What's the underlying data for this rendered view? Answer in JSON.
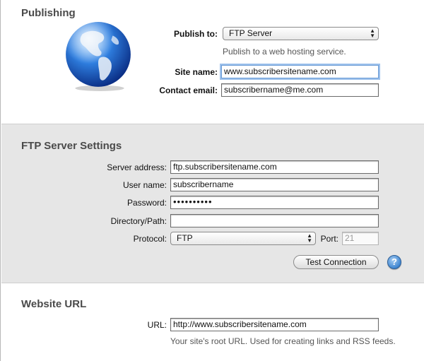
{
  "publishing": {
    "heading": "Publishing",
    "globe_icon": "globe-icon",
    "publish_to_label": "Publish to:",
    "publish_to_value": "FTP Server",
    "publish_to_hint": "Publish to a web hosting service.",
    "site_name_label": "Site name:",
    "site_name_value": "www.subscribersitename.com",
    "contact_email_label": "Contact email:",
    "contact_email_value": "subscribername@me.com"
  },
  "ftp": {
    "heading": "FTP Server Settings",
    "server_address_label": "Server address:",
    "server_address_value": "ftp.subscribersitename.com",
    "user_name_label": "User name:",
    "user_name_value": "subscribername",
    "password_label": "Password:",
    "password_value": "••••••••••",
    "directory_label": "Directory/Path:",
    "directory_value": "",
    "protocol_label": "Protocol:",
    "protocol_value": "FTP",
    "port_label": "Port:",
    "port_placeholder": "21",
    "test_connection_label": "Test Connection",
    "help_label": "?"
  },
  "website_url": {
    "heading": "Website URL",
    "url_label": "URL:",
    "url_value": "http://www.subscribersitename.com",
    "url_hint": "Your site's root URL. Used for creating links and RSS feeds."
  },
  "colors": {
    "section_gray": "#e6e6e6",
    "focus_ring": "#9cc1ec",
    "heading_text": "#4a4a4a"
  }
}
